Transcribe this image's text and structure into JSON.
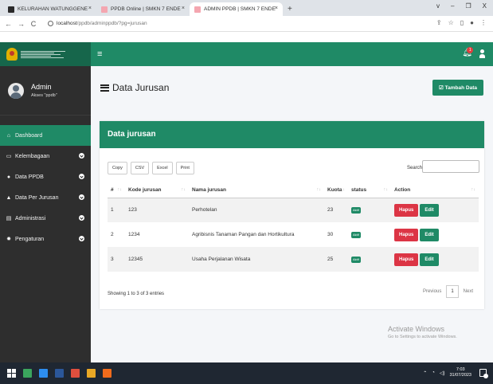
{
  "browser": {
    "tabs": [
      {
        "title": "KELURAHAN WATUNGGENE",
        "favicon_color": "#2a2a2a",
        "active": false
      },
      {
        "title": "PPDB Online | SMKN 7 ENDE",
        "favicon_color": "#f4a6b0",
        "active": false
      },
      {
        "title": "ADMIN PPDB | SMKN 7 ENDE",
        "favicon_color": "#f4a6b0",
        "active": true
      }
    ],
    "new_tab": "+",
    "url_host": "localhost",
    "url_path": "/ppdb/adminppdb/?pg=jurusan",
    "window_controls": [
      "v",
      "–",
      "❐",
      "X"
    ],
    "address_icons": [
      "share-icon",
      "star-icon",
      "split-icon",
      "profile-icon",
      "menu-icon"
    ]
  },
  "navbar": {
    "hamburger_icon": "≡",
    "notification_count": "1"
  },
  "sidebar": {
    "user_name": "Admin",
    "user_role": "Akses \"ppdb\"",
    "items": [
      {
        "label": "Dashboard",
        "icon": "home-icon",
        "glyph": "⌂",
        "active": true,
        "has_submenu": false
      },
      {
        "label": "Kelembagaan",
        "icon": "monitor-icon",
        "glyph": "▭",
        "active": false,
        "has_submenu": true
      },
      {
        "label": "Data PPDB",
        "icon": "user-icon",
        "glyph": "●",
        "active": false,
        "has_submenu": true
      },
      {
        "label": "Data Per Jurusan",
        "icon": "graduation-cap-icon",
        "glyph": "▲",
        "active": false,
        "has_submenu": true
      },
      {
        "label": "Administrasi",
        "icon": "list-icon",
        "glyph": "▤",
        "active": false,
        "has_submenu": true
      },
      {
        "label": "Pengaturan",
        "icon": "gear-icon",
        "glyph": "✹",
        "active": false,
        "has_submenu": true
      }
    ]
  },
  "page": {
    "title": "Data Jurusan",
    "add_button": "Tambah Data",
    "add_button_icon": "☑"
  },
  "card": {
    "title": "Data jurusan",
    "export_buttons": [
      "Copy",
      "CSV",
      "Excel",
      "Print"
    ],
    "search_label": "Search:",
    "search_value": "",
    "columns": [
      "#",
      "Kode jurusan",
      "Nama jurusan",
      "Kuota",
      "status",
      "Action"
    ],
    "rows": [
      {
        "no": "1",
        "kode": "123",
        "nama": "Perhotelan",
        "kuota": "23",
        "status": "Aktif"
      },
      {
        "no": "2",
        "kode": "1234",
        "nama": "Agribisnis Tanaman Pangan dan Hortikultura",
        "kuota": "30",
        "status": "Aktif"
      },
      {
        "no": "3",
        "kode": "12345",
        "nama": "Usaha Perjalanan Wisata",
        "kuota": "25",
        "status": "Aktif"
      }
    ],
    "action_delete": "Hapus",
    "action_edit": "Edit",
    "showing_text": "Showing 1 to 3 of 3 entries",
    "pager": {
      "previous": "Previous",
      "current": "1",
      "next": "Next"
    }
  },
  "watermark": {
    "line1": "Activate Windows",
    "line2": "Go to Settings to activate Windows."
  },
  "taskbar": {
    "apps": [
      {
        "name": "file-manager-icon",
        "color": "#3ba55d"
      },
      {
        "name": "folder-icon",
        "color": "#2d8ef0"
      },
      {
        "name": "word-icon",
        "color": "#2b579a"
      },
      {
        "name": "app-icon",
        "color": "#e04f3e"
      },
      {
        "name": "chrome-icon",
        "color": "#e9a825"
      },
      {
        "name": "xampp-icon",
        "color": "#f06b1c"
      }
    ],
    "time": "7:03",
    "date": "31/07/2023"
  }
}
